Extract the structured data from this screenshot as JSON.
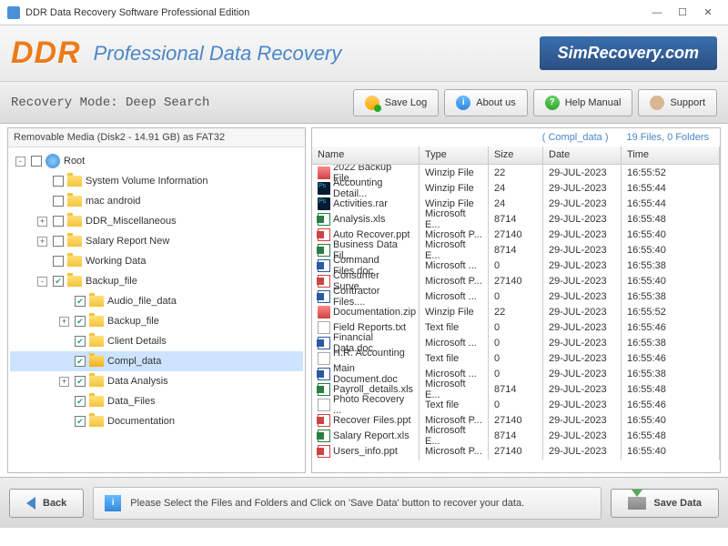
{
  "window": {
    "title": "DDR Data Recovery Software Professional Edition"
  },
  "header": {
    "logo": "DDR",
    "title": "Professional Data Recovery",
    "brand": "SimRecovery.com"
  },
  "toolbar": {
    "mode": "Recovery Mode: Deep Search",
    "save_log": "Save Log",
    "about": "About us",
    "help": "Help Manual",
    "support": "Support"
  },
  "left": {
    "title": "Removable Media (Disk2 - 14.91 GB) as FAT32",
    "tree": [
      {
        "d": 0,
        "exp": "-",
        "chk": 0,
        "ico": "root",
        "label": "Root"
      },
      {
        "d": 1,
        "exp": "",
        "chk": 0,
        "ico": "f",
        "label": "System Volume Information"
      },
      {
        "d": 1,
        "exp": "",
        "chk": 0,
        "ico": "f",
        "label": "mac android"
      },
      {
        "d": 1,
        "exp": "+",
        "chk": 0,
        "ico": "f",
        "label": "DDR_Miscellaneous"
      },
      {
        "d": 1,
        "exp": "+",
        "chk": 0,
        "ico": "f",
        "label": "Salary Report New"
      },
      {
        "d": 1,
        "exp": "",
        "chk": 0,
        "ico": "f",
        "label": "Working Data"
      },
      {
        "d": 1,
        "exp": "-",
        "chk": 1,
        "ico": "f",
        "label": "Backup_file"
      },
      {
        "d": 2,
        "exp": "",
        "chk": 1,
        "ico": "f",
        "label": "Audio_file_data"
      },
      {
        "d": 2,
        "exp": "+",
        "chk": 1,
        "ico": "f",
        "label": "Backup_file"
      },
      {
        "d": 2,
        "exp": "",
        "chk": 1,
        "ico": "f",
        "label": "Client Details"
      },
      {
        "d": 2,
        "exp": "",
        "chk": 1,
        "ico": "fo",
        "label": "Compl_data",
        "sel": 1
      },
      {
        "d": 2,
        "exp": "+",
        "chk": 1,
        "ico": "f",
        "label": "Data Analysis"
      },
      {
        "d": 2,
        "exp": "",
        "chk": 1,
        "ico": "f",
        "label": "Data_Files"
      },
      {
        "d": 2,
        "exp": "",
        "chk": 1,
        "ico": "f",
        "label": "Documentation"
      }
    ]
  },
  "right": {
    "folder": "( Compl_data )",
    "count": "19 Files, 0 Folders",
    "cols": [
      "Name",
      "Type",
      "Size",
      "Date",
      "Time"
    ],
    "rows": [
      {
        "i": "zip",
        "n": "2022 Backup File...",
        "t": "Winzip File",
        "s": "22",
        "d": "29-JUL-2023",
        "tm": "16:55:52"
      },
      {
        "i": "ps",
        "n": "Accounting Detail...",
        "t": "Winzip File",
        "s": "24",
        "d": "29-JUL-2023",
        "tm": "16:55:44"
      },
      {
        "i": "ps",
        "n": "Activities.rar",
        "t": "Winzip File",
        "s": "24",
        "d": "29-JUL-2023",
        "tm": "16:55:44"
      },
      {
        "i": "xls",
        "n": "Analysis.xls",
        "t": "Microsoft E...",
        "s": "8714",
        "d": "29-JUL-2023",
        "tm": "16:55:48"
      },
      {
        "i": "ppt",
        "n": "Auto Recover.ppt",
        "t": "Microsoft P...",
        "s": "27140",
        "d": "29-JUL-2023",
        "tm": "16:55:40"
      },
      {
        "i": "xls",
        "n": "Business Data Fil...",
        "t": "Microsoft E...",
        "s": "8714",
        "d": "29-JUL-2023",
        "tm": "16:55:40"
      },
      {
        "i": "doc",
        "n": "Command Files.doc",
        "t": "Microsoft ...",
        "s": "0",
        "d": "29-JUL-2023",
        "tm": "16:55:38"
      },
      {
        "i": "ppt",
        "n": "Consumer Surve...",
        "t": "Microsoft P...",
        "s": "27140",
        "d": "29-JUL-2023",
        "tm": "16:55:40"
      },
      {
        "i": "doc",
        "n": "Contractor Files....",
        "t": "Microsoft ...",
        "s": "0",
        "d": "29-JUL-2023",
        "tm": "16:55:38"
      },
      {
        "i": "zip",
        "n": "Documentation.zip",
        "t": "Winzip File",
        "s": "22",
        "d": "29-JUL-2023",
        "tm": "16:55:52"
      },
      {
        "i": "txt",
        "n": "Field Reports.txt",
        "t": "Text file",
        "s": "0",
        "d": "29-JUL-2023",
        "tm": "16:55:46"
      },
      {
        "i": "doc",
        "n": "Financial Data.doc",
        "t": "Microsoft ...",
        "s": "0",
        "d": "29-JUL-2023",
        "tm": "16:55:38"
      },
      {
        "i": "txt",
        "n": "H.R. Accounting ...",
        "t": "Text file",
        "s": "0",
        "d": "29-JUL-2023",
        "tm": "16:55:46"
      },
      {
        "i": "doc",
        "n": "Main Document.doc",
        "t": "Microsoft ...",
        "s": "0",
        "d": "29-JUL-2023",
        "tm": "16:55:38"
      },
      {
        "i": "xls",
        "n": "Payroll_details.xls",
        "t": "Microsoft E...",
        "s": "8714",
        "d": "29-JUL-2023",
        "tm": "16:55:48"
      },
      {
        "i": "txt",
        "n": "Photo Recovery ...",
        "t": "Text file",
        "s": "0",
        "d": "29-JUL-2023",
        "tm": "16:55:46"
      },
      {
        "i": "ppt",
        "n": "Recover Files.ppt",
        "t": "Microsoft P...",
        "s": "27140",
        "d": "29-JUL-2023",
        "tm": "16:55:40"
      },
      {
        "i": "xls",
        "n": "Salary Report.xls",
        "t": "Microsoft E...",
        "s": "8714",
        "d": "29-JUL-2023",
        "tm": "16:55:48"
      },
      {
        "i": "ppt",
        "n": "Users_info.ppt",
        "t": "Microsoft P...",
        "s": "27140",
        "d": "29-JUL-2023",
        "tm": "16:55:40"
      }
    ]
  },
  "footer": {
    "back": "Back",
    "msg": "Please Select the Files and Folders and Click on 'Save Data' button to recover your data.",
    "save": "Save Data"
  }
}
